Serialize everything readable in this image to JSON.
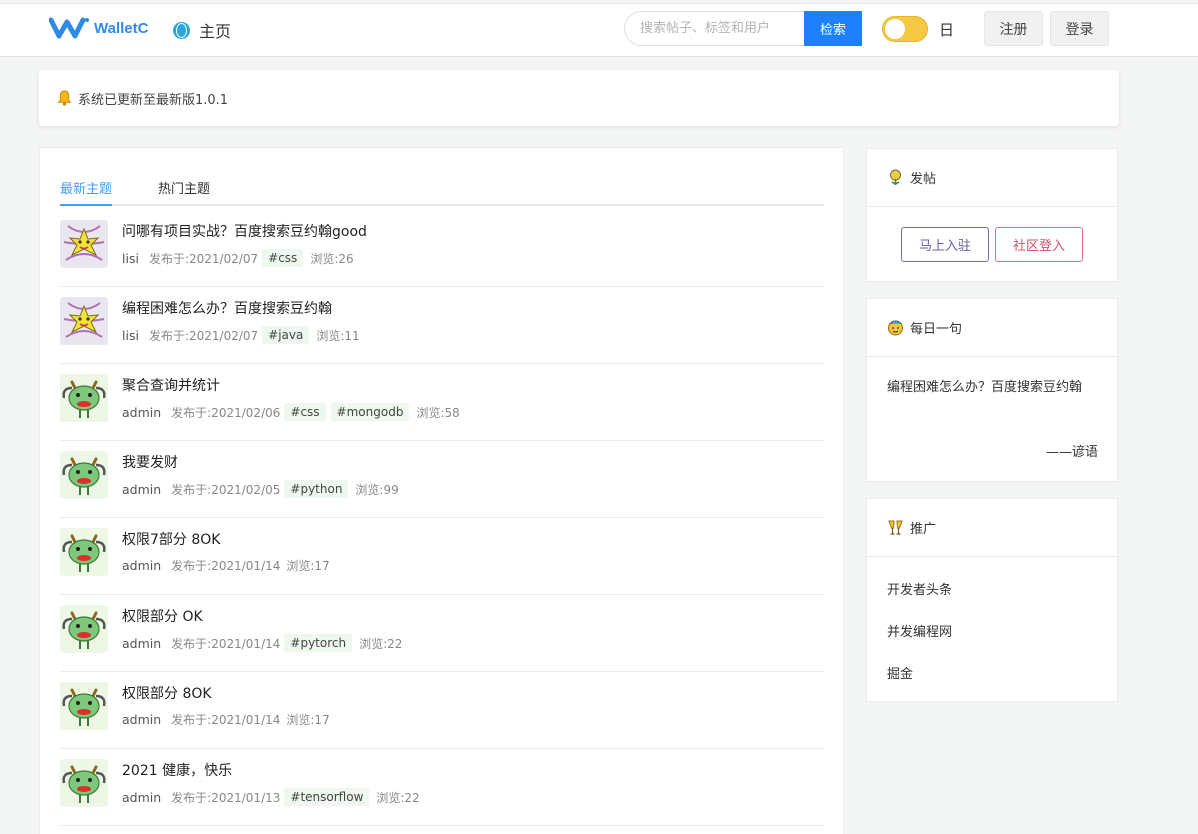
{
  "header": {
    "logo_text": "WalletC",
    "home_label": "主页",
    "search_placeholder": "搜索帖子、标签和用户",
    "search_button": "检索",
    "theme_label": "日",
    "register_label": "注册",
    "login_label": "登录",
    "brand_color": "#2f8be6"
  },
  "notice": {
    "text": "系统已更新至最新版1.0.1"
  },
  "tabs": {
    "latest": "最新主题",
    "hot": "热门主题"
  },
  "posts": [
    {
      "title": "问哪有项目实战？百度搜索豆约翰good",
      "author": "lisi",
      "date": "发布于:2021/02/07",
      "tags": [
        "#css"
      ],
      "views": "浏览:26",
      "avatar": "lisi"
    },
    {
      "title": "编程困难怎么办？百度搜索豆约翰",
      "author": "lisi",
      "date": "发布于:2021/02/07",
      "tags": [
        "#java"
      ],
      "views": "浏览:11",
      "avatar": "lisi"
    },
    {
      "title": "聚合查询并统计",
      "author": "admin",
      "date": "发布于:2021/02/06",
      "tags": [
        "#css",
        "#mongodb"
      ],
      "views": "浏览:58",
      "avatar": "admin"
    },
    {
      "title": "我要发财",
      "author": "admin",
      "date": "发布于:2021/02/05",
      "tags": [
        "#python"
      ],
      "views": "浏览:99",
      "avatar": "admin"
    },
    {
      "title": "权限7部分 8OK",
      "author": "admin",
      "date": "发布于:2021/01/14",
      "tags": [],
      "views": "浏览:17",
      "avatar": "admin"
    },
    {
      "title": "权限部分 OK",
      "author": "admin",
      "date": "发布于:2021/01/14",
      "tags": [
        "#pytorch"
      ],
      "views": "浏览:22",
      "avatar": "admin"
    },
    {
      "title": "权限部分 8OK",
      "author": "admin",
      "date": "发布于:2021/01/14",
      "tags": [],
      "views": "浏览:17",
      "avatar": "admin"
    },
    {
      "title": "2021 健康，快乐",
      "author": "admin",
      "date": "发布于:2021/01/13",
      "tags": [
        "#tensorflow"
      ],
      "views": "浏览:22",
      "avatar": "admin"
    }
  ],
  "sidebar": {
    "post_card": {
      "title": "发帖",
      "join_button": "马上入驻",
      "community_button": "社区登入"
    },
    "daily_card": {
      "title": "每日一句",
      "quote": "编程困难怎么办？百度搜索豆约翰",
      "source": "——谚语"
    },
    "promo_card": {
      "title": "推广",
      "links": [
        "开发者头条",
        "并发编程网",
        "掘金"
      ]
    }
  }
}
